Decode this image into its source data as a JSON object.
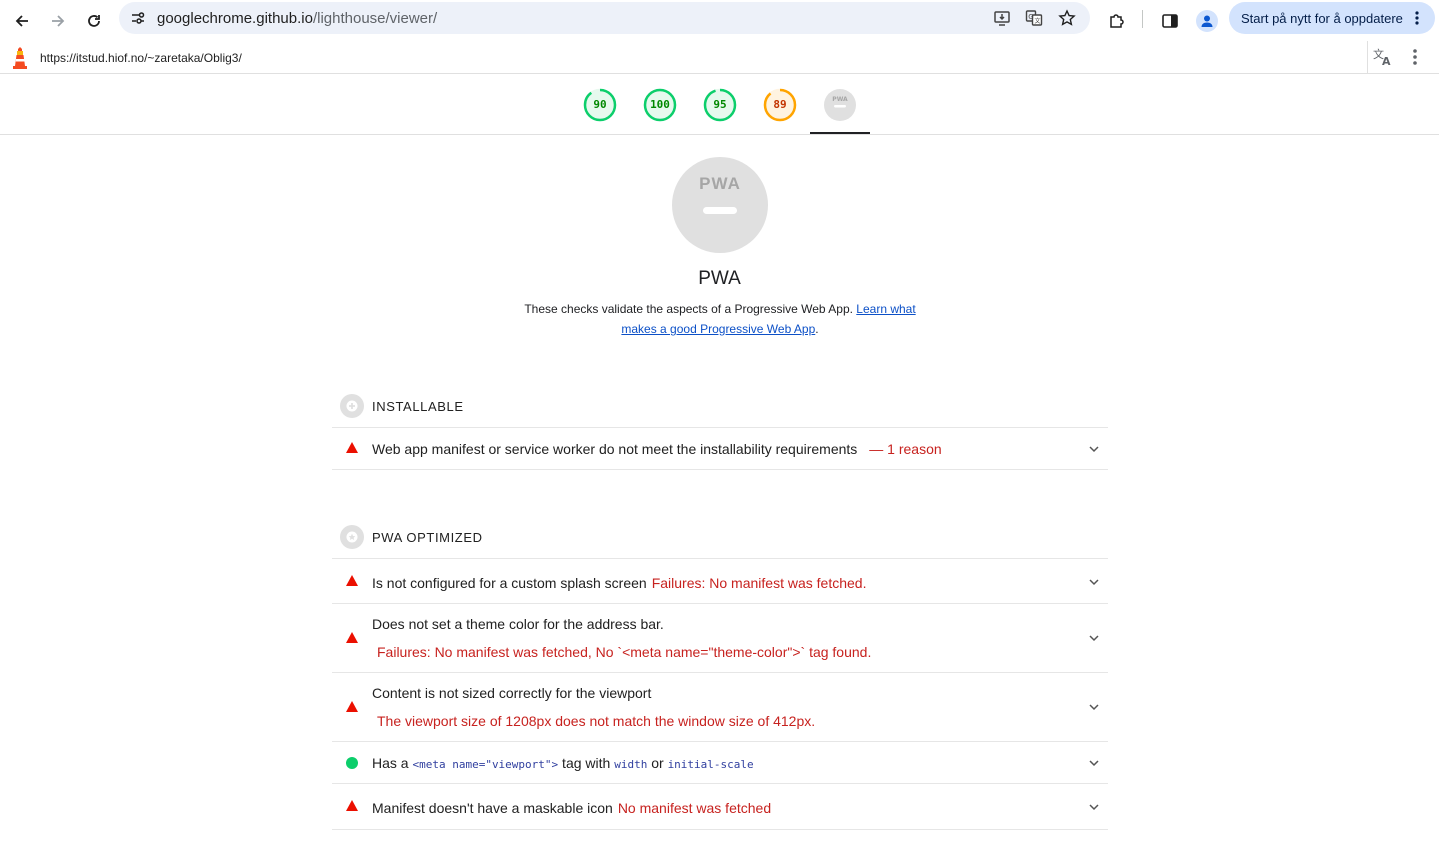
{
  "browser": {
    "url_host": "googlechrome.github.io",
    "url_path": "/lighthouse/viewer/",
    "restart_label": "Start på nytt for å oppdatere"
  },
  "lighthouse": {
    "report_url": "https://itstud.hiof.no/~zaretaka/Oblig3/"
  },
  "scores": [
    {
      "value": "90",
      "color": "#0cce6b",
      "text_color": "#008800",
      "fraction": 0.9
    },
    {
      "value": "100",
      "color": "#0cce6b",
      "text_color": "#008800",
      "fraction": 1.0
    },
    {
      "value": "95",
      "color": "#0cce6b",
      "text_color": "#008800",
      "fraction": 0.95
    },
    {
      "value": "89",
      "color": "#ffa400",
      "text_color": "#c33300",
      "fraction": 0.89
    },
    {
      "value": "PWA",
      "color": "#e0e0e0",
      "text_color": "#9e9e9e",
      "fraction": 0
    }
  ],
  "category": {
    "badge": "PWA",
    "title": "PWA",
    "description": "These checks validate the aspects of a Progressive Web App. ",
    "link_text": "Learn what makes a good Progressive Web App",
    "after_link": "."
  },
  "groups": {
    "installable": {
      "label": "INSTALLABLE",
      "audits": [
        {
          "title": "Web app manifest or service worker do not meet the installability requirements",
          "extra": "— 1 reason"
        }
      ]
    },
    "optimized": {
      "label": "PWA OPTIMIZED",
      "audits": [
        {
          "title": "Is not configured for a custom splash screen",
          "extra": "Failures: No manifest was fetched."
        },
        {
          "title": "Does not set a theme color for the address bar.",
          "extra": "Failures: No manifest was fetched, No `<meta name=\"theme-color\">` tag found."
        },
        {
          "title": "Content is not sized correctly for the viewport",
          "extra": "The viewport size of 1208px does not match the window size of 412px."
        },
        {
          "title_parts": [
            "Has a ",
            "<meta name=\"viewport\">",
            " tag with ",
            "width",
            " or ",
            "initial-scale"
          ]
        },
        {
          "title": "Manifest doesn't have a maskable icon",
          "extra": "No manifest was fetched"
        }
      ]
    }
  }
}
